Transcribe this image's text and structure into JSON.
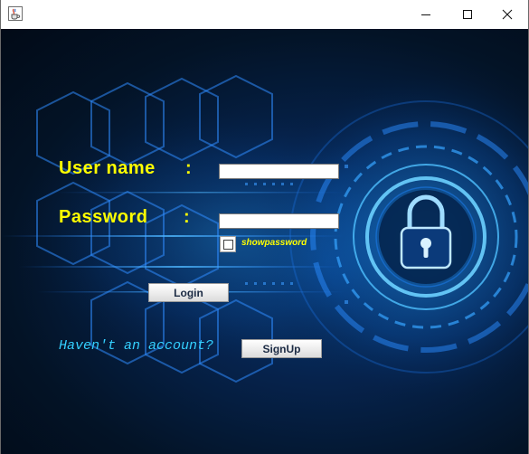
{
  "window": {
    "icon": "java-cup-icon",
    "controls": [
      "minimize-icon",
      "maximize-icon",
      "close-icon"
    ]
  },
  "form": {
    "username_label": "User name",
    "password_label": "Password",
    "colon": ":",
    "username_value": "",
    "password_value": "",
    "show_password_label": "showpassword",
    "show_password_checked": false,
    "login_label": "Login",
    "no_account_text": "Haven't an account?",
    "signup_label": "SignUp"
  },
  "background": {
    "icon": "padlock-icon",
    "label_color": "#ffff00",
    "link_color": "#34d0ff"
  }
}
